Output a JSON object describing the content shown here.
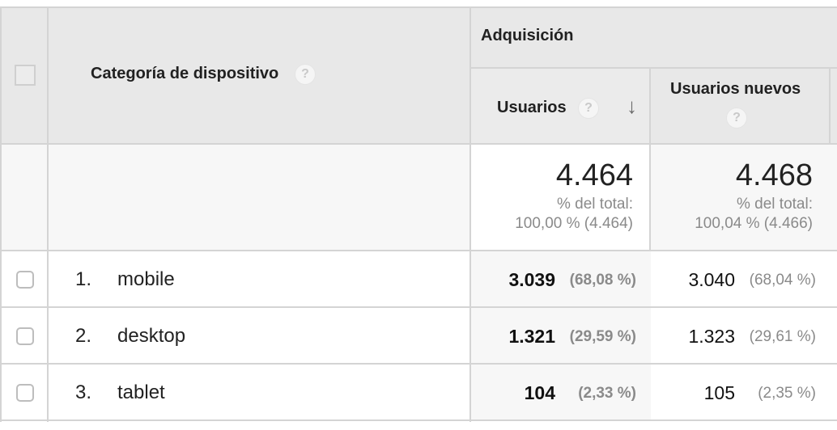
{
  "header": {
    "group_label": "Adquisición",
    "dimension_label": "Categoría de dispositivo",
    "metrics": [
      {
        "label": "Usuarios",
        "help": "?",
        "sort": "↓"
      },
      {
        "label": "Usuarios nuevos",
        "help": "?"
      }
    ],
    "dimension_help": "?"
  },
  "totals": [
    {
      "value": "4.464",
      "pct_label": "% del total:",
      "pct_detail": "100,00 % (4.464)"
    },
    {
      "value": "4.468",
      "pct_label": "% del total:",
      "pct_detail": "100,04 % (4.466)"
    }
  ],
  "rows": [
    {
      "num": "1.",
      "name": "mobile",
      "users": "3.039",
      "users_pct": "(68,08 %)",
      "new": "3.040",
      "new_pct": "(68,04 %)"
    },
    {
      "num": "2.",
      "name": "desktop",
      "users": "1.321",
      "users_pct": "(29,59 %)",
      "new": "1.323",
      "new_pct": "(29,61 %)"
    },
    {
      "num": "3.",
      "name": "tablet",
      "users": "104",
      "users_pct": "(2,33 %)",
      "new": "105",
      "new_pct": "(2,35 %)"
    }
  ]
}
